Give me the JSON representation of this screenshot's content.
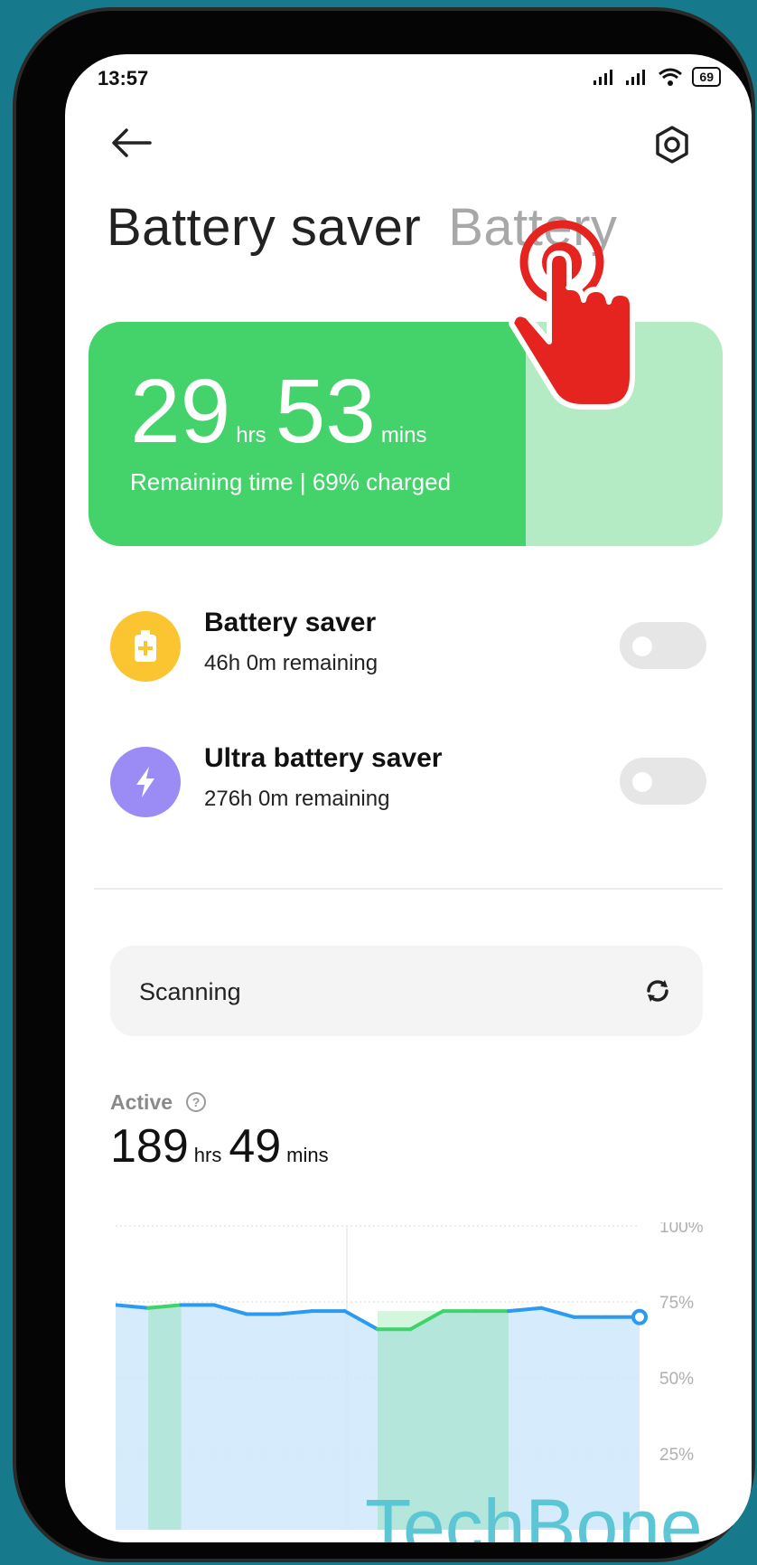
{
  "status_bar": {
    "time": "13:57",
    "battery_level": "69"
  },
  "header": {
    "back_icon": "back-arrow-icon",
    "settings_icon": "settings-gear-icon"
  },
  "tabs": [
    {
      "label": "Battery saver",
      "active": true
    },
    {
      "label": "Battery",
      "active": false
    }
  ],
  "summary": {
    "hours": "29",
    "hours_unit": "hrs",
    "minutes": "53",
    "minutes_unit": "mins",
    "subtitle": "Remaining time | 69% charged",
    "charge_percent": 69,
    "fill_color": "#44d26a",
    "track_color": "#b4ebc4"
  },
  "modes": [
    {
      "title": "Battery saver",
      "subtitle": "46h 0m remaining",
      "icon": "battery-plus-icon",
      "color": "#fbc531",
      "enabled": false
    },
    {
      "title": "Ultra battery saver",
      "subtitle": "276h 0m remaining",
      "icon": "lightning-bolt-icon",
      "color": "#9b8cf5",
      "enabled": false
    }
  ],
  "scan": {
    "label": "Scanning",
    "icon": "refresh-icon"
  },
  "active": {
    "label": "Active",
    "hours": "189",
    "hours_unit": "hrs",
    "minutes": "49",
    "minutes_unit": "mins",
    "help_icon": "help-icon"
  },
  "chart_data": {
    "type": "area",
    "y_tick_labels": [
      "100%",
      "75%",
      "50%",
      "25%"
    ],
    "ylim": [
      0,
      100
    ],
    "grid": true,
    "series": [
      {
        "values": [
          74,
          73,
          74,
          74,
          71,
          71,
          72,
          72,
          66,
          66,
          72,
          72,
          72,
          73,
          70,
          70,
          70
        ]
      }
    ],
    "charging_segments": [
      [
        1,
        2
      ],
      [
        8,
        12
      ]
    ],
    "line_color": "#2b9af3",
    "charging_color": "#3fd46a",
    "fill_color": "#cfe8fb"
  },
  "watermark": "TechBone"
}
